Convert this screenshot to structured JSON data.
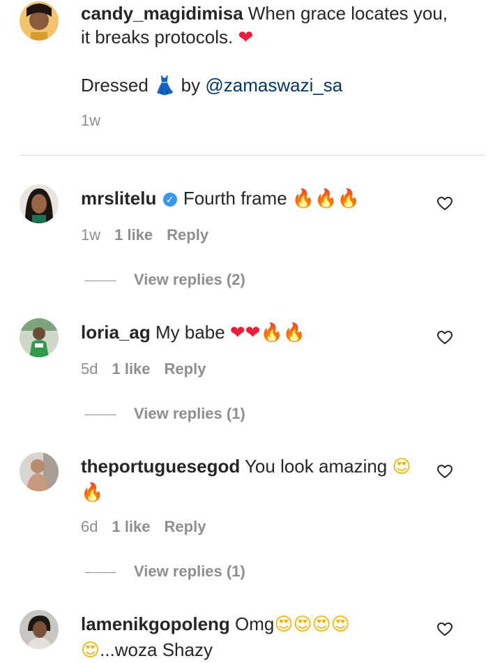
{
  "caption": {
    "username": "candy_magidimisa",
    "text_line1": " When grace locates you,",
    "text_line2": "it breaks protocols. ",
    "heart_emoji": "❤",
    "dressed_prefix": "Dressed",
    "dress_emoji": "👗",
    "by_text": " by ",
    "mention": "@zamaswazi_sa",
    "time": "1w"
  },
  "comments": [
    {
      "username": "mrslitelu",
      "verified": true,
      "text": " Fourth frame ",
      "emojis": "🔥🔥🔥",
      "time": "1w",
      "likes": "1 like",
      "reply": "Reply",
      "view_replies": "View replies (2)"
    },
    {
      "username": "loria_ag",
      "text": " My babe ",
      "emojis_hearts": "❤❤",
      "emojis_fire": "🔥🔥",
      "time": "5d",
      "likes": "1 like",
      "reply": "Reply",
      "view_replies": "View replies (1)"
    },
    {
      "username": "theportuguesegod",
      "text": " You look amazing ",
      "emoji_face": "😍",
      "emoji_fire": "🔥",
      "time": "6d",
      "likes": "1 like",
      "reply": "Reply",
      "view_replies": "View replies (1)"
    },
    {
      "username": "lamenikgopoleng",
      "text": " Omg",
      "emojis_faces": "😍😍😍😍",
      "emoji_face2": "😍",
      "text2": "...woza Shazy"
    }
  ],
  "colors": {
    "text": "#262626",
    "secondary": "#8e8e8e",
    "link": "#00376b",
    "verified": "#3897f0"
  },
  "icons": {
    "like": "heart-outline-icon",
    "verified": "verified-badge-icon"
  }
}
